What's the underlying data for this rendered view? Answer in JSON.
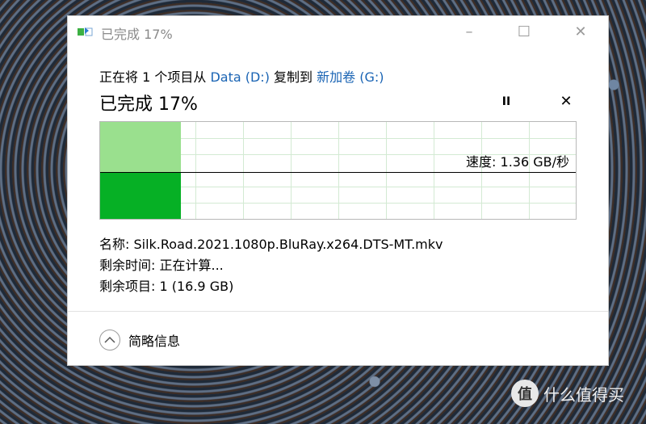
{
  "window": {
    "title": "已完成 17%"
  },
  "copy": {
    "prefix": "正在将 1 个项目从",
    "source": "Data (D:)",
    "middle": "复制到",
    "destination": "新加卷 (G:)",
    "status": "已完成 17%",
    "pause_symbol": "II",
    "cancel_symbol": "✕"
  },
  "graph": {
    "speed_text": "速度: 1.36 GB/秒",
    "progress_fraction": 0.17,
    "accent_light": "#9ae08e",
    "accent_dark": "#06b025"
  },
  "details": {
    "name": "名称: Silk.Road.2021.1080p.BluRay.x264.DTS-MT.mkv",
    "time_remaining": "剩余时间: 正在计算...",
    "items_remaining": "剩余项目: 1 (16.9 GB)"
  },
  "footer": {
    "toggle_label": "简略信息",
    "toggle_icon": "chevron-up-icon"
  },
  "watermark": {
    "text": "什么值得买"
  }
}
